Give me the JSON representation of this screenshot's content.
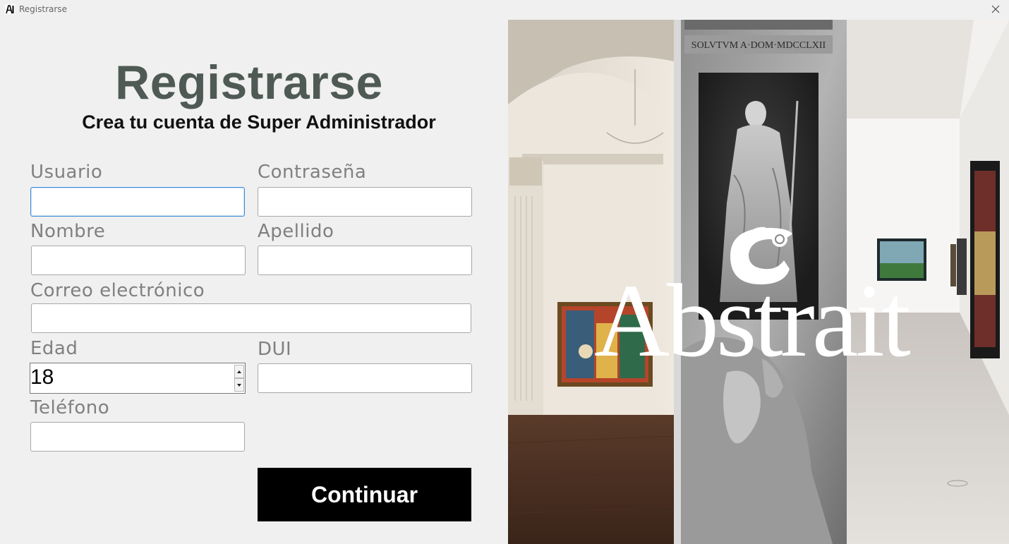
{
  "window": {
    "title": "Registrarse",
    "icon": "abstrait-app-icon",
    "close_icon": "close-icon"
  },
  "form": {
    "title": "Registrarse",
    "subtitle": "Crea tu cuenta de Super Administrador",
    "fields": {
      "usuario": {
        "label": "Usuario",
        "value": ""
      },
      "contrasena": {
        "label": "Contraseña",
        "value": ""
      },
      "nombre": {
        "label": "Nombre",
        "value": ""
      },
      "apellido": {
        "label": "Apellido",
        "value": ""
      },
      "correo": {
        "label": "Correo electrónico",
        "value": ""
      },
      "edad": {
        "label": "Edad",
        "value": "18"
      },
      "dui": {
        "label": "DUI",
        "value": ""
      },
      "telefono": {
        "label": "Teléfono",
        "value": ""
      }
    },
    "continue_label": "Continuar"
  },
  "hero": {
    "brand": "Abstrait",
    "inscription": "SOLVTVM A·DOM·MDCCLXII",
    "logo_icon": "chameleon-logo-icon",
    "colors": {
      "brand_text": "#ffffff",
      "button_bg": "#000000",
      "title": "#4f5a54"
    }
  }
}
